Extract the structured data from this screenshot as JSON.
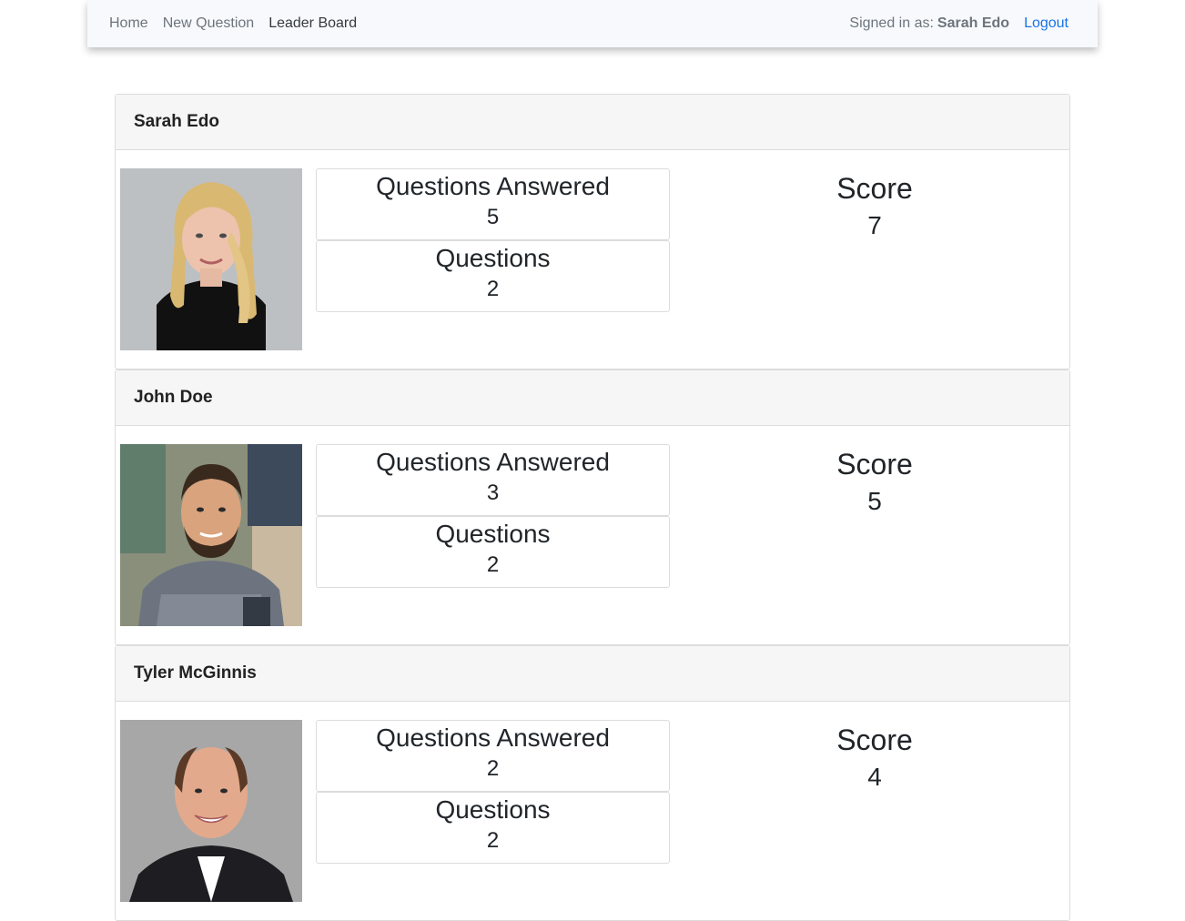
{
  "nav": {
    "links": [
      "Home",
      "New Question",
      "Leader Board"
    ],
    "signed_in_label": "Signed in as:",
    "signed_in_user": "Sarah Edo",
    "logout": "Logout"
  },
  "leaderboard": [
    {
      "name": "Sarah Edo",
      "answered_label": "Questions Answered",
      "answered": "5",
      "questions_label": "Questions",
      "questions": "2",
      "score_label": "Score",
      "score": "7"
    },
    {
      "name": "John Doe",
      "answered_label": "Questions Answered",
      "answered": "3",
      "questions_label": "Questions",
      "questions": "2",
      "score_label": "Score",
      "score": "5"
    },
    {
      "name": "Tyler McGinnis",
      "answered_label": "Questions Answered",
      "answered": "2",
      "questions_label": "Questions",
      "questions": "2",
      "score_label": "Score",
      "score": "4"
    }
  ],
  "colors": {
    "link": "#1a73e8",
    "muted": "#6c757d",
    "nav_bg": "#f8f9fc",
    "card_header_bg": "#f6f6f6"
  }
}
